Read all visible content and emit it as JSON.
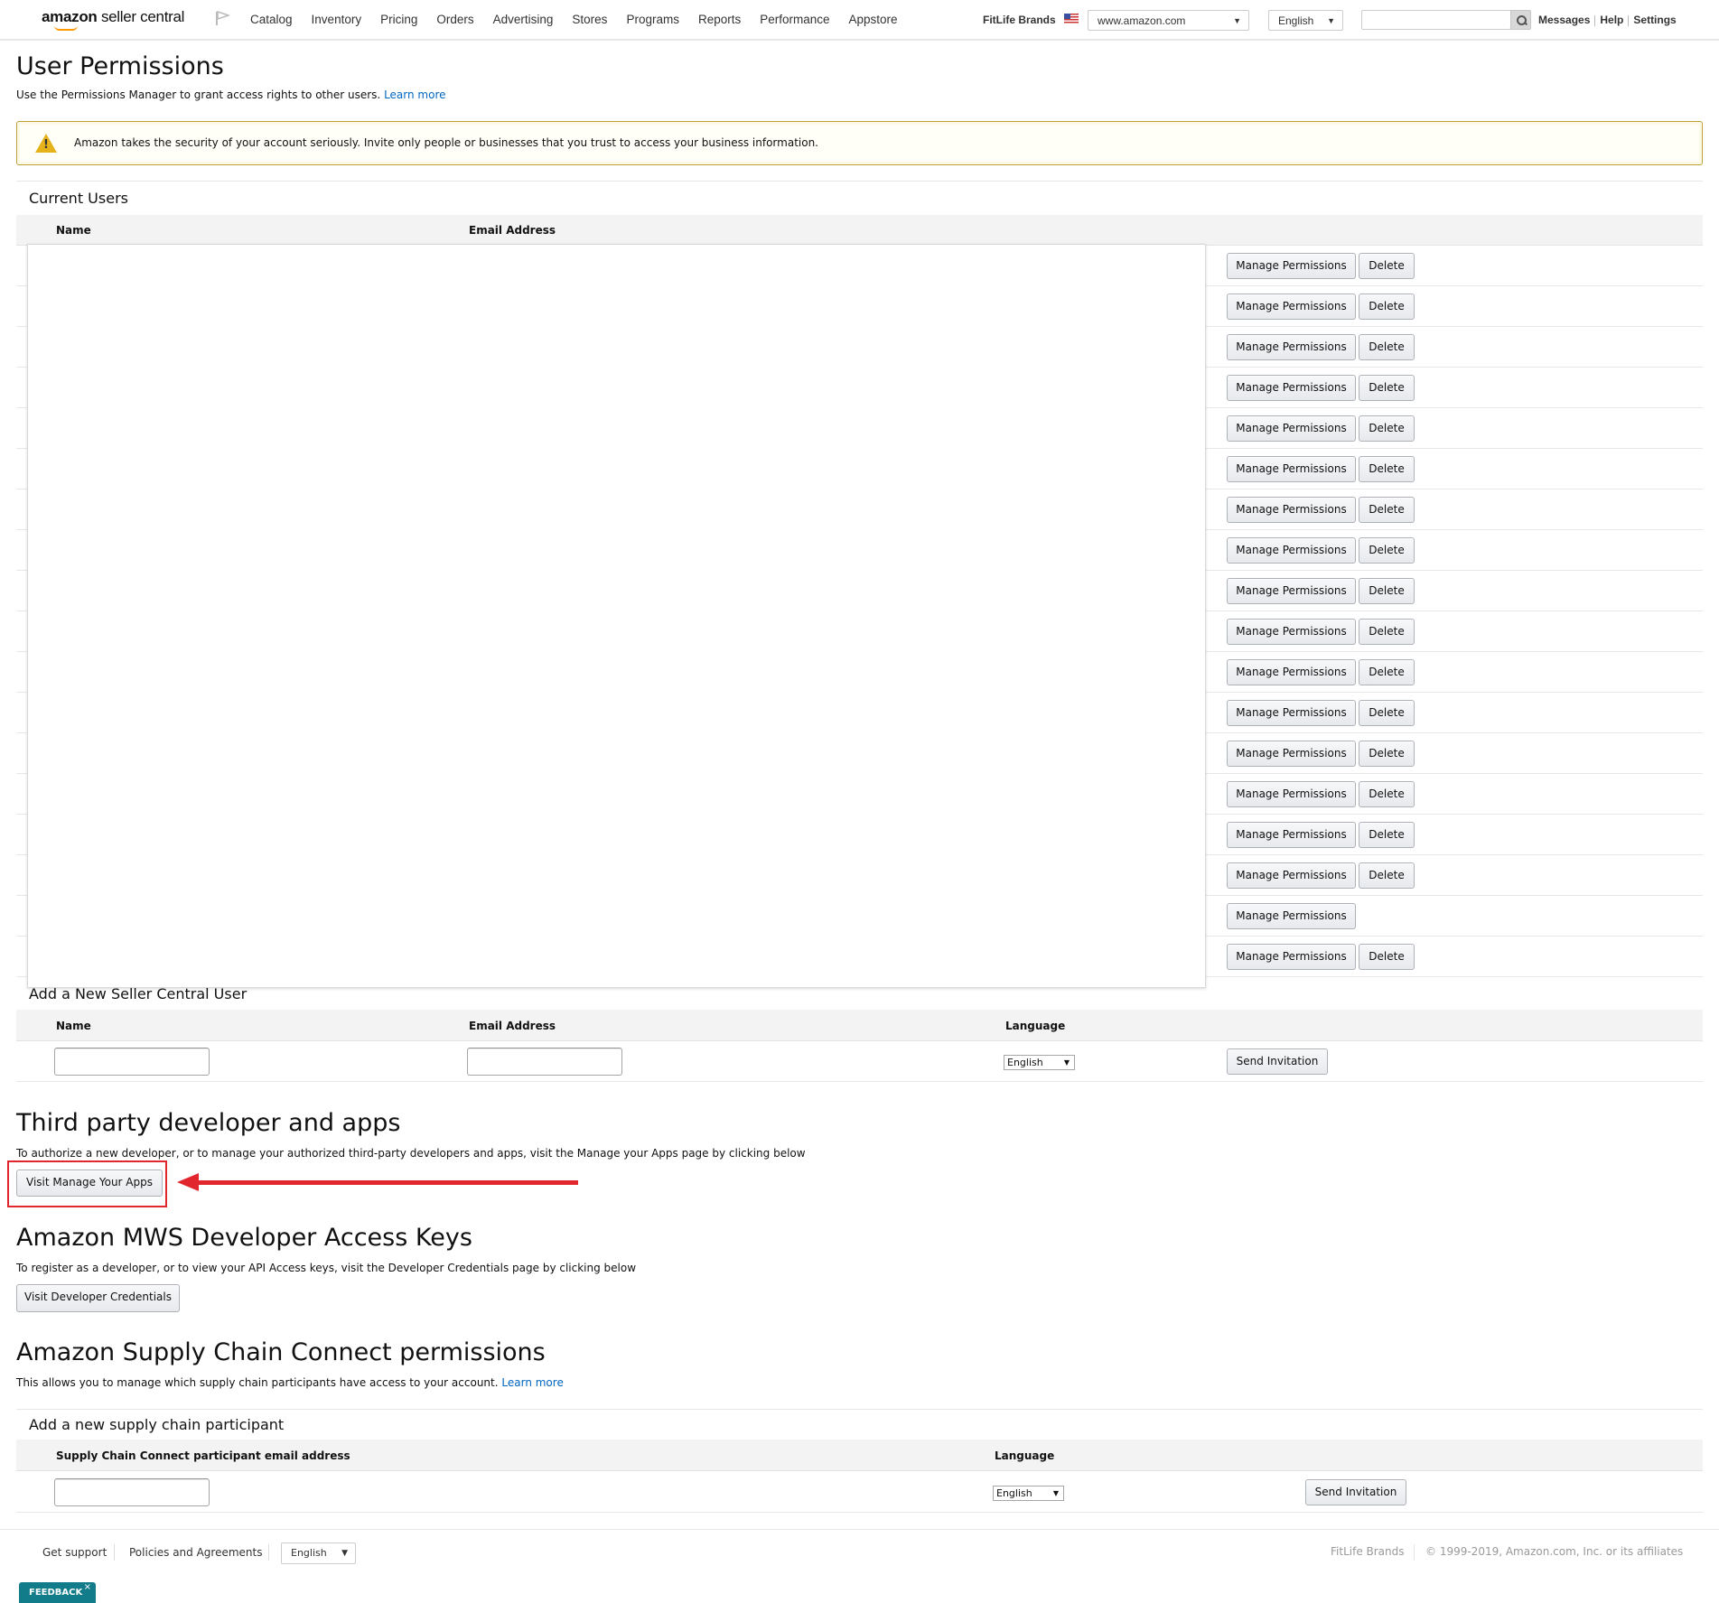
{
  "header": {
    "logo_brand": "amazon",
    "logo_product": "seller central",
    "nav": [
      "Catalog",
      "Inventory",
      "Pricing",
      "Orders",
      "Advertising",
      "Stores",
      "Programs",
      "Reports",
      "Performance",
      "Appstore"
    ],
    "account_name": "FitLife Brands",
    "marketplace": "www.amazon.com",
    "language": "English",
    "search_value": "",
    "links": [
      "Messages",
      "Help",
      "Settings"
    ]
  },
  "page": {
    "title": "User Permissions",
    "subtitle": "Use the Permissions Manager to grant access rights to other users.",
    "subtitle_link": "Learn more",
    "alert_text": "Amazon takes the security of your account seriously. Invite only people or businesses that you trust to access your business information."
  },
  "current_users": {
    "title": "Current Users",
    "columns": [
      "Name",
      "Email Address"
    ],
    "manage_label": "Manage Permissions",
    "delete_label": "Delete",
    "rows": [
      {
        "has_delete": true
      },
      {
        "has_delete": true
      },
      {
        "has_delete": true
      },
      {
        "has_delete": true
      },
      {
        "has_delete": true
      },
      {
        "has_delete": true
      },
      {
        "has_delete": true
      },
      {
        "has_delete": true
      },
      {
        "has_delete": true
      },
      {
        "has_delete": true
      },
      {
        "has_delete": true
      },
      {
        "has_delete": true
      },
      {
        "has_delete": true
      },
      {
        "has_delete": true
      },
      {
        "has_delete": true
      },
      {
        "has_delete": true
      },
      {
        "has_delete": false
      },
      {
        "has_delete": true
      }
    ]
  },
  "add_user": {
    "title": "Add a New Seller Central User",
    "columns": [
      "Name",
      "Email Address",
      "Language"
    ],
    "name_value": "",
    "email_value": "",
    "language": "English",
    "send_label": "Send Invitation"
  },
  "third_party": {
    "title": "Third party developer and apps",
    "text": "To authorize a new developer, or to manage your authorized third-party developers and apps, visit the Manage your Apps page by clicking below",
    "button": "Visit Manage Your Apps"
  },
  "mws": {
    "title": "Amazon MWS Developer Access Keys",
    "text": "To register as a developer, or to view your API Access keys, visit the Developer Credentials page by clicking below",
    "button": "Visit Developer Credentials"
  },
  "supply_chain": {
    "title": "Amazon Supply Chain Connect permissions",
    "text": "This allows you to manage which supply chain participants have access to your account.",
    "link": "Learn more",
    "subsection_title": "Add a new supply chain participant",
    "columns": [
      "Supply Chain Connect participant email address",
      "Language"
    ],
    "email_value": "",
    "language": "English",
    "send_label": "Send Invitation"
  },
  "footer": {
    "links": [
      "Get support",
      "Policies and Agreements"
    ],
    "language": "English",
    "account_name": "FitLife Brands",
    "copyright": "© 1999-2019, Amazon.com, Inc. or its affiliates",
    "feedback_label": "FEEDBACK",
    "feedback_close": "×"
  },
  "colors": {
    "link": "#0066c0",
    "alert_border": "#c0a03b",
    "annotation_red": "#e1262d",
    "feedback_bg": "#137c8a"
  }
}
